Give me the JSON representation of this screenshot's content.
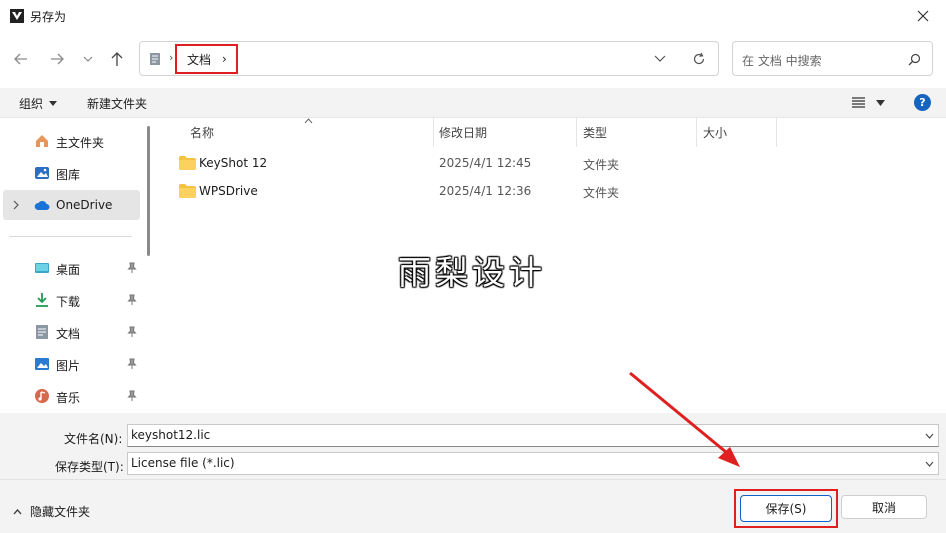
{
  "window": {
    "title": "另存为"
  },
  "address": {
    "crumb": "文档",
    "sep": "›",
    "crumb_chevron": "›"
  },
  "search": {
    "placeholder": "在 文档 中搜索"
  },
  "commands": {
    "organize": "组织",
    "new_folder": "新建文件夹",
    "help": "?"
  },
  "nav": {
    "items": [
      {
        "label": "主文件夹"
      },
      {
        "label": "图库"
      },
      {
        "label": "OneDrive"
      },
      {
        "label": "桌面"
      },
      {
        "label": "下载"
      },
      {
        "label": "文档"
      },
      {
        "label": "图片"
      },
      {
        "label": "音乐"
      }
    ]
  },
  "columns": {
    "name": "名称",
    "modified": "修改日期",
    "type": "类型",
    "size": "大小"
  },
  "files": [
    {
      "name": "KeyShot 12",
      "modified": "2025/4/1 12:45",
      "type": "文件夹"
    },
    {
      "name": "WPSDrive",
      "modified": "2025/4/1 12:36",
      "type": "文件夹"
    }
  ],
  "watermark": "雨梨设计",
  "form": {
    "filename_label": "文件名(N):",
    "filename_value": "keyshot12.lic",
    "filetype_label": "保存类型(T):",
    "filetype_value": "License file (*.lic)"
  },
  "footer": {
    "hide_folders": "隐藏文件夹",
    "save": "保存(S)",
    "cancel": "取消"
  },
  "colors": {
    "accent": "#0f62c9",
    "highlight": "#e02020",
    "folder": "#f5c342"
  }
}
